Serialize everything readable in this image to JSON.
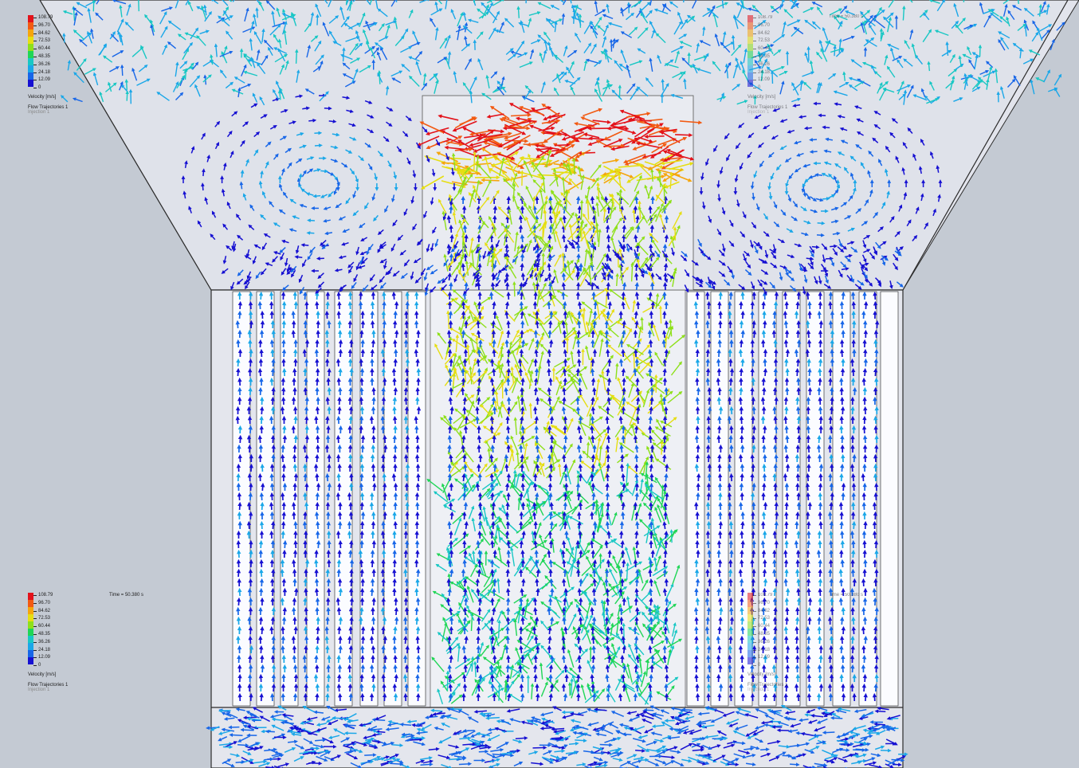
{
  "legend": {
    "ticks": [
      "108.79",
      "96.70",
      "84.62",
      "72.53",
      "60.44",
      "48.35",
      "36.26",
      "24.18",
      "12.09",
      "0"
    ],
    "unit_label": "Velocity [m/s]",
    "trajectory_label": "Flow Trajectories 1",
    "injection_label": "Injection 1",
    "colors": [
      "#e3121a",
      "#f25a12",
      "#f5a50c",
      "#e6de12",
      "#8ee01a",
      "#1fd656",
      "#18c7c4",
      "#1aa7e8",
      "#1766e8",
      "#1610d2"
    ]
  },
  "time_readout": "Time = 50.380 s",
  "scene": {
    "background_color": "#c4cad3",
    "housing_color": "#e2e4ec",
    "edge_color": "#2b2b2b"
  }
}
